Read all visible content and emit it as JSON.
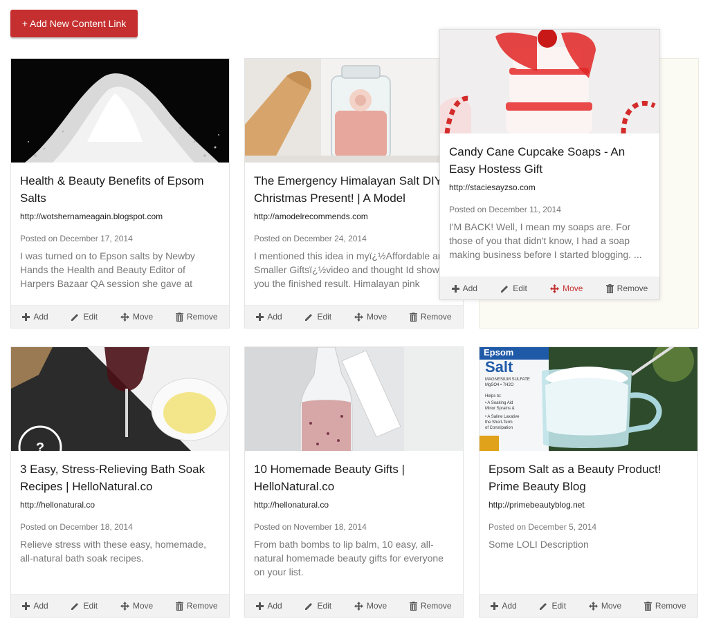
{
  "toolbar": {
    "add_label": "+ Add New Content Link"
  },
  "actions": {
    "add": "Add",
    "edit": "Edit",
    "move": "Move",
    "remove": "Remove"
  },
  "colors": {
    "accent": "#c62f2f",
    "placeholder": "#fcfbf3",
    "action_bar": "#f2f2f2"
  },
  "cards": [
    {
      "title": "Health & Beauty Benefits of Epsom Salts",
      "url": "http://wotshernameagain.blogspot.com",
      "date": "Posted on December 17, 2014",
      "desc": "I was turned on to Epson salts by Newby Hands the Health and Beauty Editor of Harpers Bazaar QA session she gave at",
      "image": "pile-of-epsom-salt-photo"
    },
    {
      "title": "The Emergency Himalayan Salt DIY Christmas Present! | A Model",
      "url": "http://amodelrecommends.com",
      "date": "Posted on December 24, 2014",
      "desc": "I mentioned this idea in myï¿½Affordable and Smaller Giftsï¿½video and thought Id show you the finished result. Himalayan pink",
      "image": "salt-jar-with-rose-photo"
    },
    {
      "title": "Candy Cane Cupcake Soaps - An Easy Hostess Gift",
      "url": "http://staciesayzso.com",
      "date": "Posted on December 11, 2014",
      "desc": "I'M BACK! Well, I mean my soaps are. For those of you that didn't know, I had a soap making business before I started blogging. ...",
      "image": "cupcake-soaps-photo"
    },
    {
      "title": "3 Easy, Stress-Relieving Bath Soak Recipes | HelloNatural.co",
      "url": "http://hellonatural.co",
      "date": "Posted on December 18, 2014",
      "desc": "Relieve stress with these easy, homemade, all-natural bath soak recipes.",
      "image": "bath-soak-ingredients-photo"
    },
    {
      "title": "10 Homemade Beauty Gifts | HelloNatural.co",
      "url": "http://hellonatural.co",
      "date": "Posted on November 18, 2014",
      "desc": "From bath bombs to lip balm, 10 easy, all-natural homemade beauty gifts for everyone on your list.",
      "image": "bath-salt-bottle-photo"
    },
    {
      "title": "Epsom Salt as a Beauty Product! Prime Beauty Blog",
      "url": "http://primebeautyblog.net",
      "date": "Posted on December 5, 2014",
      "desc": "Some LOLI Description",
      "image": "epsom-salt-box-and-cup-photo",
      "box_text": {
        "line1": "Epsom",
        "line2": "Salt",
        "line3": "MAGNESIUM SULFATE",
        "line4": "MgSO4 • 7H2O",
        "line5": "Helps to:",
        "line6": "• A Soaking Aid",
        "line7": "Minor Sprains &",
        "line8": "• A Saline Laxative",
        "line9": "the Short-Term",
        "line10": "of Constipation"
      }
    }
  ]
}
